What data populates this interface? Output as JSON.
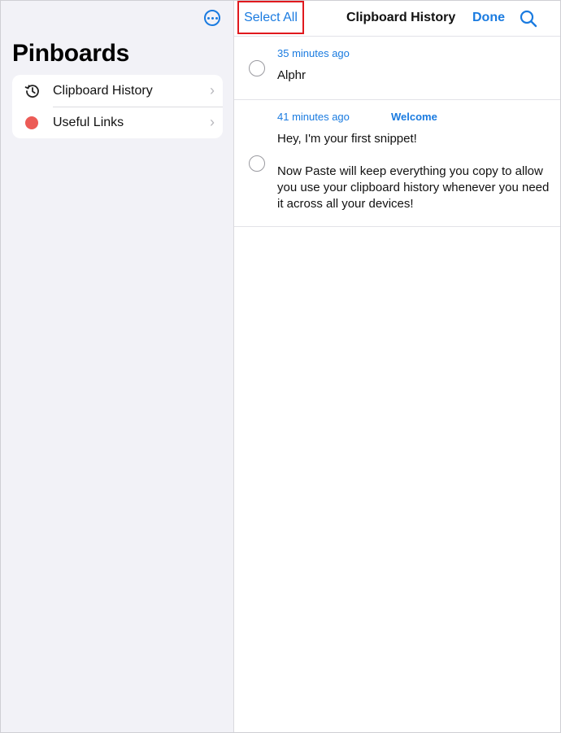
{
  "sidebar": {
    "title": "Pinboards",
    "more_icon": "ellipsis-circle-icon",
    "items": [
      {
        "label": "Clipboard History",
        "icon": "history-clock-icon"
      },
      {
        "label": "Useful Links",
        "icon": "red-dot-icon",
        "color": "#ec5b56"
      }
    ]
  },
  "toolbar": {
    "select_all_label": "Select All",
    "title": "Clipboard History",
    "done_label": "Done",
    "search_icon": "search-icon"
  },
  "clips": [
    {
      "time": "35 minutes ago",
      "text": "Alphr"
    },
    {
      "time": "41 minutes ago",
      "tag": "Welcome",
      "line1": "Hey, I'm your first snippet!",
      "line2": "Now Paste will keep everything you copy to allow you use your clipboard history whenever you need it across all your devices!"
    }
  ],
  "colors": {
    "accent": "#1a7be0",
    "highlight_box": "#e0191e",
    "sidebar_bg": "#f2f2f7"
  }
}
